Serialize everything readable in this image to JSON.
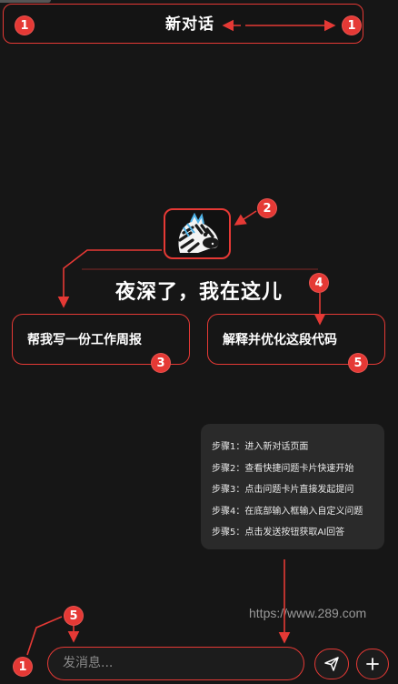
{
  "header": {
    "title": "新对话"
  },
  "greeting": "夜深了，我在这儿",
  "cards": [
    {
      "label": "帮我写一份工作周报"
    },
    {
      "label": "解释并优化这段代码"
    }
  ],
  "steps": [
    "步骤1：进入新对话页面",
    "步骤2：查看快捷问题卡片快速开始",
    "步骤3：点击问题卡片直接发起提问",
    "步骤4：在底部输入框输入自定义问题",
    "步骤5：点击发送按钮获取AI回答"
  ],
  "input": {
    "placeholder": "发消息..."
  },
  "watermark": "https://www.289.com",
  "badges": {
    "b1": "1",
    "b2": "2",
    "b3": "3",
    "b4": "4",
    "b5": "5"
  },
  "icons": {
    "send": "send-icon",
    "add": "plus-icon",
    "logo": "zebra-logo"
  },
  "colors": {
    "accent": "#e53935",
    "background": "#161616",
    "panel": "#2a2a2a"
  }
}
